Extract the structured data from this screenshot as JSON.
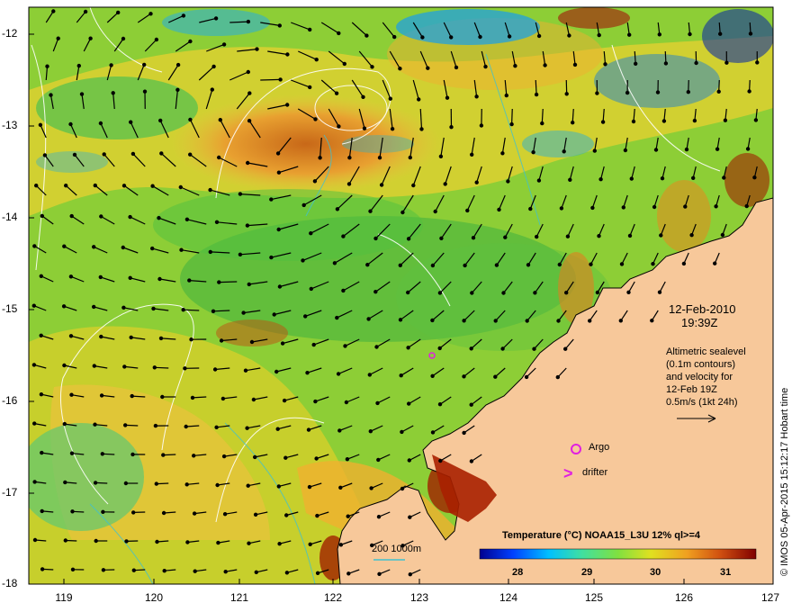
{
  "map": {
    "date": "12-Feb-2010",
    "time": "19:39Z",
    "altimetry_lines": [
      "Altimetric sealevel",
      "(0.1m contours)",
      "and velocity for",
      "12-Feb 19Z",
      "0.5m/s (1kt 24h)"
    ],
    "legend_argo": "Argo",
    "legend_drifter": "drifter",
    "legend_drifter_symbol": ">",
    "depth_legend": "200  1000m",
    "colorbar_title": "Temperature (°C) NOAA15_L3U 12% ql>=4",
    "colorbar_ticks": [
      "28",
      "29",
      "30",
      "31"
    ],
    "credit": "© IMOS 05-Apr-2015 15:12:17 Hobart time",
    "lat_labels": [
      "-12",
      "-13",
      "-14",
      "-15",
      "-16",
      "-17",
      "-18"
    ],
    "lon_labels": [
      "119",
      "120",
      "121",
      "122",
      "123",
      "124",
      "125",
      "126",
      "127"
    ],
    "colors": {
      "land": "#f7c89a",
      "argo": "#e020e0",
      "drifter": "#e020e0",
      "depth_contour": "#40c0d0",
      "sealevel_contour": "#ffffff",
      "colorbar": [
        "#00008f",
        "#0040ff",
        "#00c0ff",
        "#40e0a0",
        "#80e040",
        "#e0e020",
        "#f0a020",
        "#d05010",
        "#800000"
      ]
    },
    "chart_data": {
      "type": "heatmap",
      "title": "Temperature (°C) NOAA15_L3U 12% ql>=4",
      "xlim": [
        118.6,
        127
      ],
      "ylim": [
        -18,
        -11.7
      ],
      "value_range": [
        27.5,
        31.5
      ]
    }
  }
}
